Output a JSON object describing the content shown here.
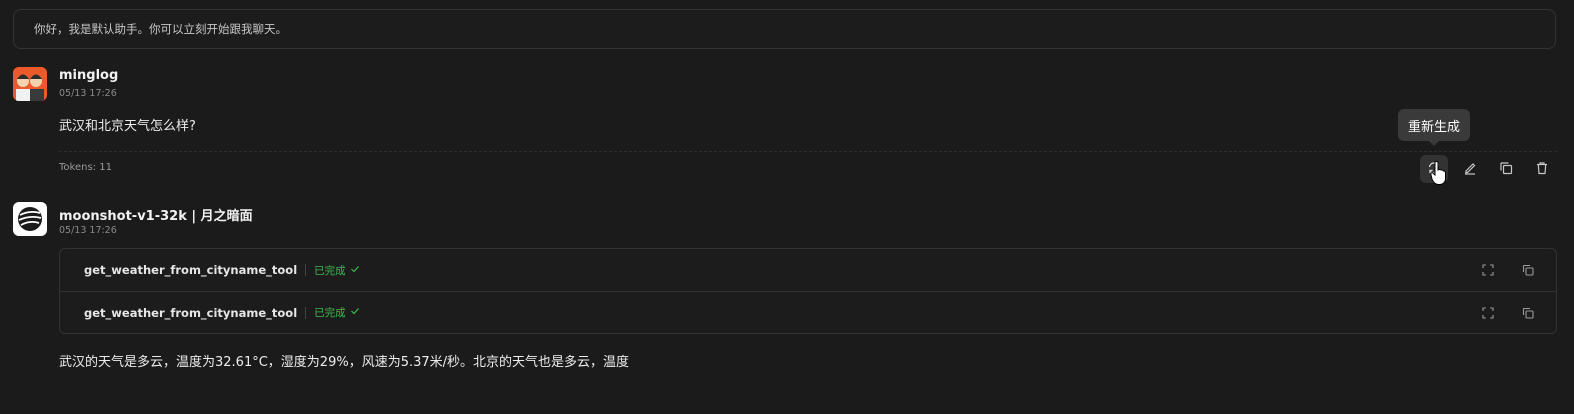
{
  "welcome": {
    "text": "你好，我是默认助手。你可以立刻开始跟我聊天。"
  },
  "user_message": {
    "sender": "minglog",
    "timestamp": "05/13 17:26",
    "text": "武汉和北京天气怎么样?",
    "tokens": "Tokens: 11"
  },
  "actions": {
    "tooltip": "重新生成",
    "icons": [
      "regenerate-icon",
      "edit-icon",
      "copy-icon",
      "delete-icon"
    ]
  },
  "assistant_message": {
    "sender": "moonshot-v1-32k | 月之暗面",
    "timestamp": "05/13 17:26",
    "tool_calls": [
      {
        "name": "get_weather_from_cityname_tool",
        "status": "已完成"
      },
      {
        "name": "get_weather_from_cityname_tool",
        "status": "已完成"
      }
    ],
    "text": "武汉的天气是多云，温度为32.61°C，湿度为29%，风速为5.37米/秒。北京的天气也是多云，温度"
  },
  "colors": {
    "background": "#1b1b1b",
    "success": "#3fb950",
    "user_avatar": "#ea5a2b"
  }
}
